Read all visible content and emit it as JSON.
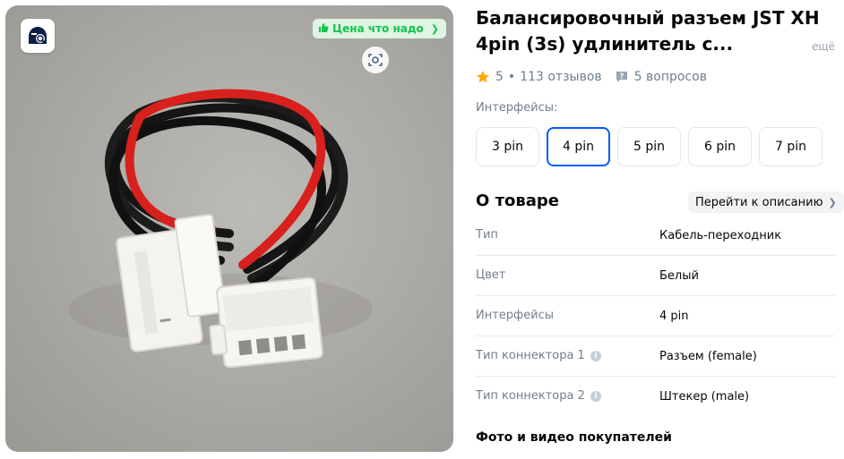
{
  "image": {
    "price_badge": "Цена что надо",
    "icons": [
      "search-photo-icon",
      "thumbs-up-icon",
      "chevron-right-icon",
      "scan-icon"
    ]
  },
  "product": {
    "title": "Балансировочный разъем JST XH 4pin (3s) удлинитель с...",
    "more_link": "ещё",
    "rating": "5",
    "reviews": "113 отзывов",
    "questions": "5 вопросов"
  },
  "interfaces": {
    "label": "Интерфейсы:",
    "options": [
      "3 pin",
      "4 pin",
      "5 pin",
      "6 pin",
      "7 pin"
    ],
    "selected": "4 pin"
  },
  "about": {
    "title": "О товаре",
    "goto_label": "Перейти к описанию",
    "specs": [
      {
        "key": "Тип",
        "value": "Кабель-переходник"
      },
      {
        "key": "Цвет",
        "value": "Белый"
      },
      {
        "key": "Интерфейсы",
        "value": "4 pin"
      },
      {
        "key": "Тип коннектора 1",
        "value": "Разъем (female)"
      },
      {
        "key": "Тип коннектора 2",
        "value": "Штекер (male)"
      }
    ]
  },
  "buyer_media_title": "Фото и видео покупателей",
  "colors": {
    "accent": "#005bff",
    "badge_green": "#10c44c",
    "star": "#ffa800",
    "muted": "#707f8d"
  }
}
